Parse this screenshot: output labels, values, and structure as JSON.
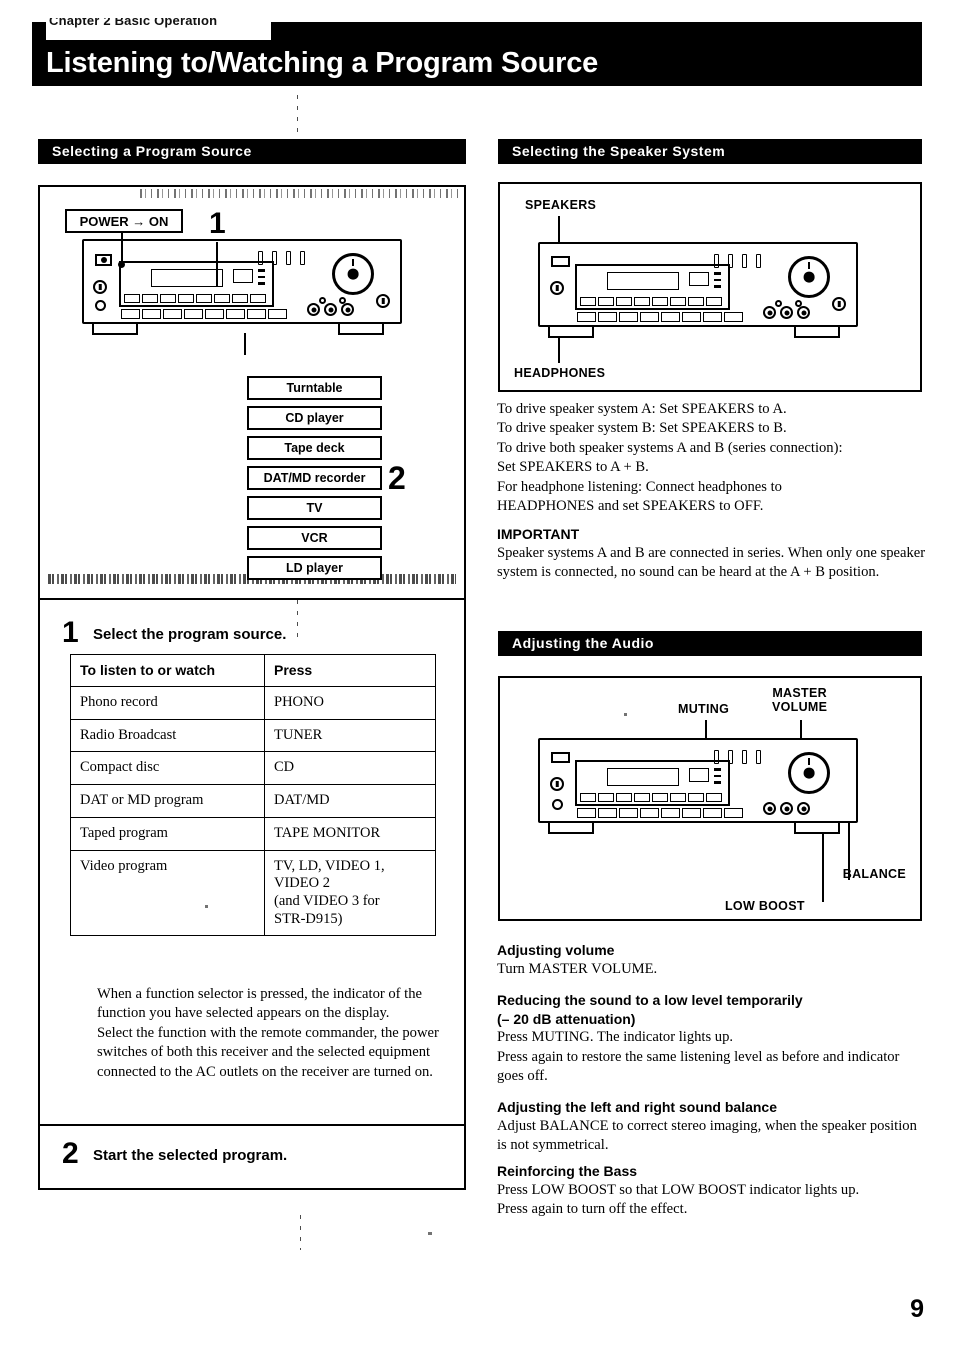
{
  "page": {
    "chapter_tab": "Chapter 2 Basic Operation",
    "title": "Listening to/Watching a Program Source",
    "page_number": "9"
  },
  "sections": {
    "selecting_source": {
      "heading": "Selecting a Program Source"
    },
    "selecting_speaker": {
      "heading": "Selecting the Speaker System"
    },
    "adjusting_audio": {
      "heading": "Adjusting the Audio"
    }
  },
  "figure_source": {
    "power_callout": "POWER → ON",
    "step_marker_1": "1",
    "step_marker_2": "2",
    "source_boxes": [
      "Turntable",
      "CD player",
      "Tape deck",
      "DAT/MD recorder",
      "TV",
      "VCR",
      "LD player"
    ]
  },
  "steps": [
    {
      "number": "1",
      "text": "Select the program source."
    },
    {
      "number": "2",
      "text": "Start the selected program."
    }
  ],
  "source_table": {
    "headers": [
      "To listen to or watch",
      "Press"
    ],
    "rows": [
      {
        "listen": "Phono record",
        "press": "PHONO"
      },
      {
        "listen": "Radio Broadcast",
        "press": "TUNER"
      },
      {
        "listen": "Compact disc",
        "press": "CD"
      },
      {
        "listen": "DAT or MD program",
        "press": "DAT/MD"
      },
      {
        "listen": "Taped program",
        "press": "TAPE  MONITOR"
      },
      {
        "listen": "Video program",
        "press": "TV, LD, VIDEO 1,\nVIDEO 2\n(and VIDEO 3 for\nSTR-D915)"
      }
    ]
  },
  "source_notes": {
    "para1": "When a function selector is pressed, the indicator of the function you have selected appears on the display.",
    "para2": "Select the function with the remote commander, the power switches of both this receiver and the selected equipment connected to the AC outlets on the receiver are turned on."
  },
  "figure_speaker": {
    "labels": {
      "speakers": "SPEAKERS",
      "headphones": "HEADPHONES"
    }
  },
  "speaker_text": {
    "lines": [
      "To drive speaker system A:  Set SPEAKERS to A.",
      "To drive speaker system B:  Set SPEAKERS to B.",
      "To drive both speaker systems A and B (series connection):",
      "Set SPEAKERS to A + B.",
      "For headphone listening: Connect headphones to",
      "HEADPHONES and set SPEAKERS to OFF."
    ],
    "important_heading": "IMPORTANT",
    "important_body": "Speaker systems A and B are connected in series.  When only one speaker system is connected, no sound can be heard at the A + B position."
  },
  "figure_audio": {
    "labels": {
      "muting": "MUTING",
      "master_volume_line1": "MASTER",
      "master_volume_line2": "VOLUME",
      "balance": "BALANCE",
      "low_boost": "LOW BOOST"
    }
  },
  "audio_topics": [
    {
      "heading": "Adjusting volume",
      "body": "Turn MASTER VOLUME."
    },
    {
      "heading": "Reducing the sound to a low level temporarily",
      "heading2": "(– 20 dB attenuation)",
      "body": "Press MUTING.  The indicator lights up.\nPress again to restore the same listening level as before and indicator goes off."
    },
    {
      "heading": "Adjusting the left and right sound balance",
      "body": "Adjust BALANCE to correct stereo imaging, when the speaker position is not symmetrical."
    },
    {
      "heading": "Reinforcing the Bass",
      "body": "Press LOW BOOST so that LOW BOOST indicator lights up.\nPress again to turn off the effect."
    }
  ],
  "colors": {
    "ink": "#000000",
    "paper": "#ffffff"
  }
}
